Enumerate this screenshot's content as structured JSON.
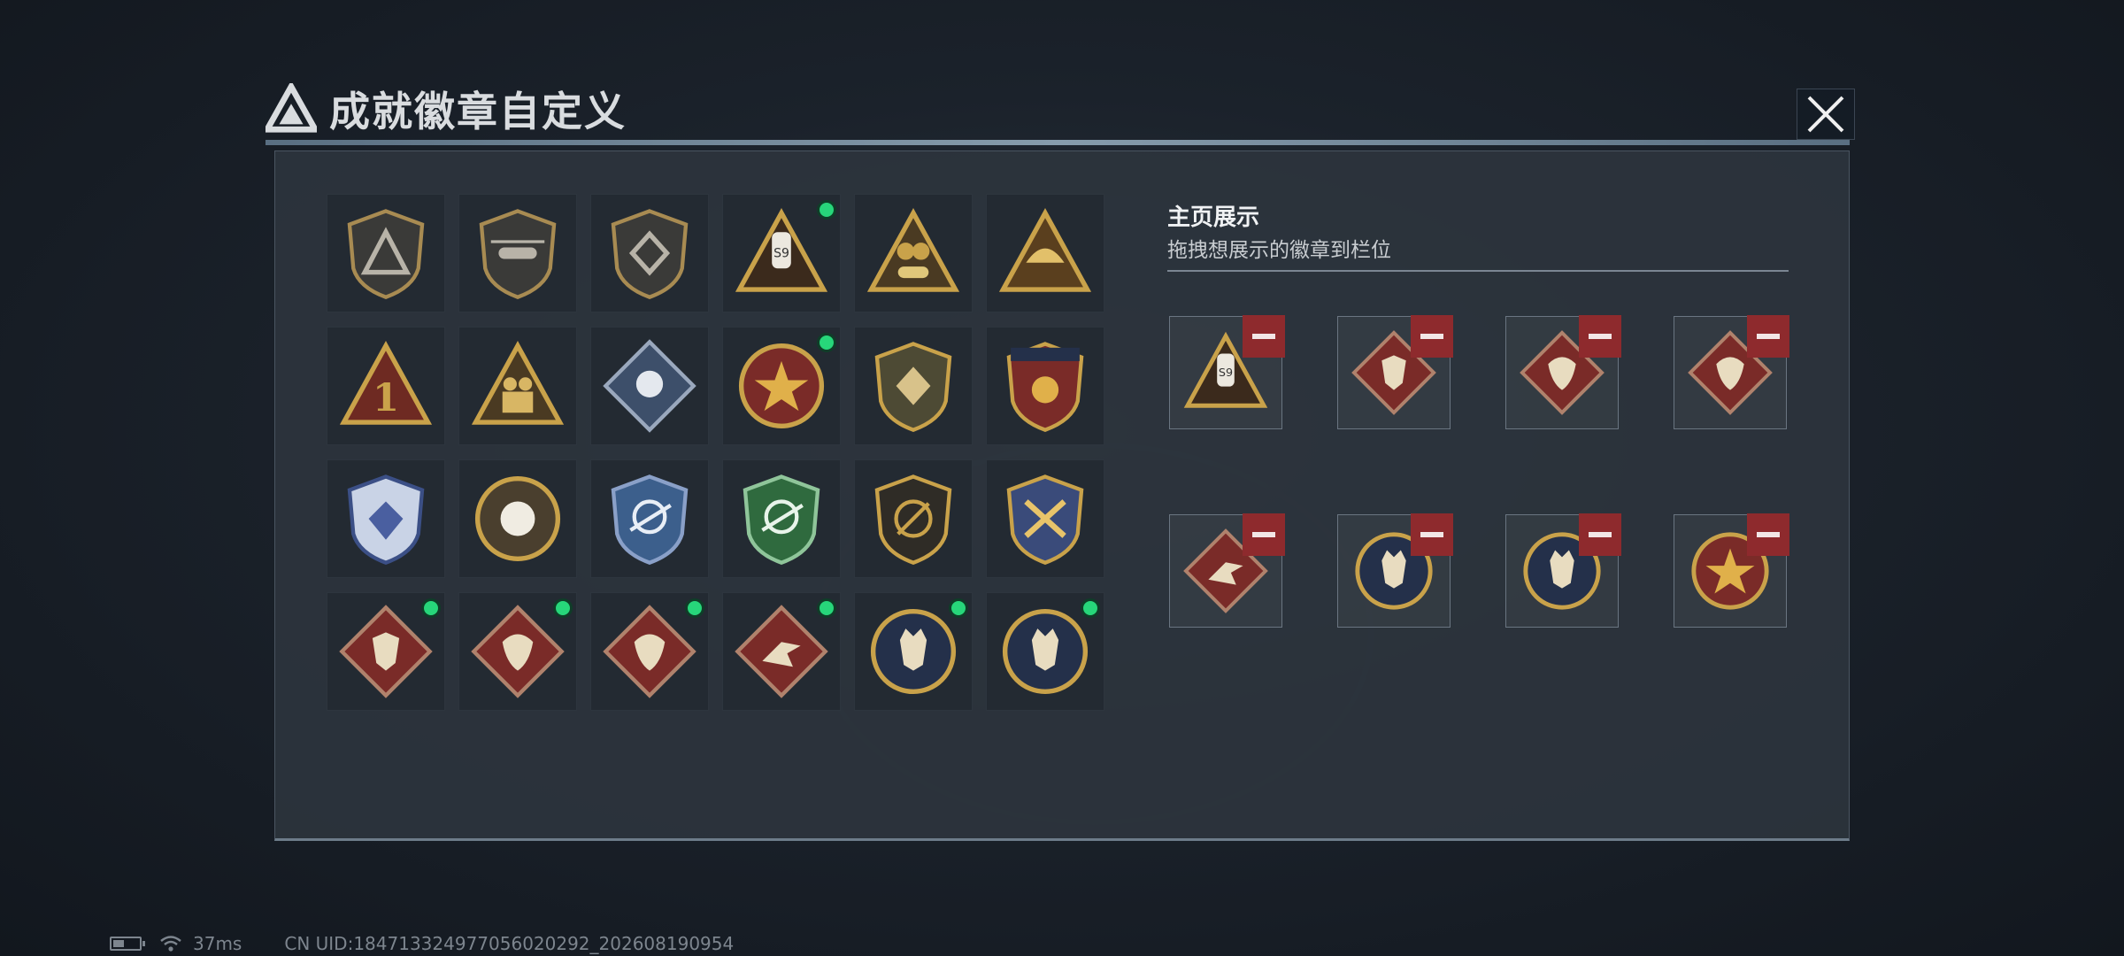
{
  "dialog": {
    "title": "成就徽章自定义",
    "title_icon": "triangle-logo-icon",
    "close_icon": "close-icon"
  },
  "display": {
    "title": "主页展示",
    "subtitle": "拖拽想展示的徽章到栏位"
  },
  "badge_grid": [
    {
      "icon": "triangle-shield-badge",
      "new": false
    },
    {
      "icon": "helicopter-shield-badge",
      "new": false
    },
    {
      "icon": "diamond-shield-badge",
      "new": false
    },
    {
      "icon": "drone-s9-badge",
      "new": true
    },
    {
      "icon": "gold-s18-badge",
      "new": false
    },
    {
      "icon": "gold-wing-triangle-badge",
      "new": false
    },
    {
      "icon": "number-one-triangle-badge",
      "new": false
    },
    {
      "icon": "soldiers-triangle-badge",
      "new": false
    },
    {
      "icon": "rose-diamond-badge",
      "new": false
    },
    {
      "icon": "star-round-badge",
      "new": true
    },
    {
      "icon": "olive-shield-badge",
      "new": false
    },
    {
      "icon": "banner-shield-badge",
      "new": false
    },
    {
      "icon": "blue-gem-shield-badge",
      "new": false
    },
    {
      "icon": "gold-orb-badge",
      "new": false
    },
    {
      "icon": "blue-sniper-shield-badge",
      "new": false
    },
    {
      "icon": "green-rifle-shield-badge",
      "new": false
    },
    {
      "icon": "slash-shield-badge",
      "new": false
    },
    {
      "icon": "gold-star-shield-badge",
      "new": false
    },
    {
      "icon": "wolf-diamond-badge",
      "new": true
    },
    {
      "icon": "dragon-diamond-badge",
      "new": true
    },
    {
      "icon": "dragon-diamond-badge",
      "new": true
    },
    {
      "icon": "runner-diamond-badge",
      "new": true
    },
    {
      "icon": "lynx-round-badge",
      "new": true
    },
    {
      "icon": "lynx-round-badge",
      "new": true
    }
  ],
  "display_slots": [
    {
      "icon": "drone-s9-badge"
    },
    {
      "icon": "wolf-diamond-badge"
    },
    {
      "icon": "dragon-diamond-badge"
    },
    {
      "icon": "dragon-diamond-badge"
    },
    {
      "icon": "runner-diamond-badge"
    },
    {
      "icon": "lynx-round-badge"
    },
    {
      "icon": "lynx-round-badge"
    },
    {
      "icon": "star-round-badge"
    }
  ],
  "status": {
    "ping": "37ms",
    "uid": "CN UID:18471332497705602029​2_202608190954"
  },
  "colors": {
    "accent_green": "#27d67a",
    "remove_red": "#8e2a2d",
    "gold": "#c9a24a"
  }
}
